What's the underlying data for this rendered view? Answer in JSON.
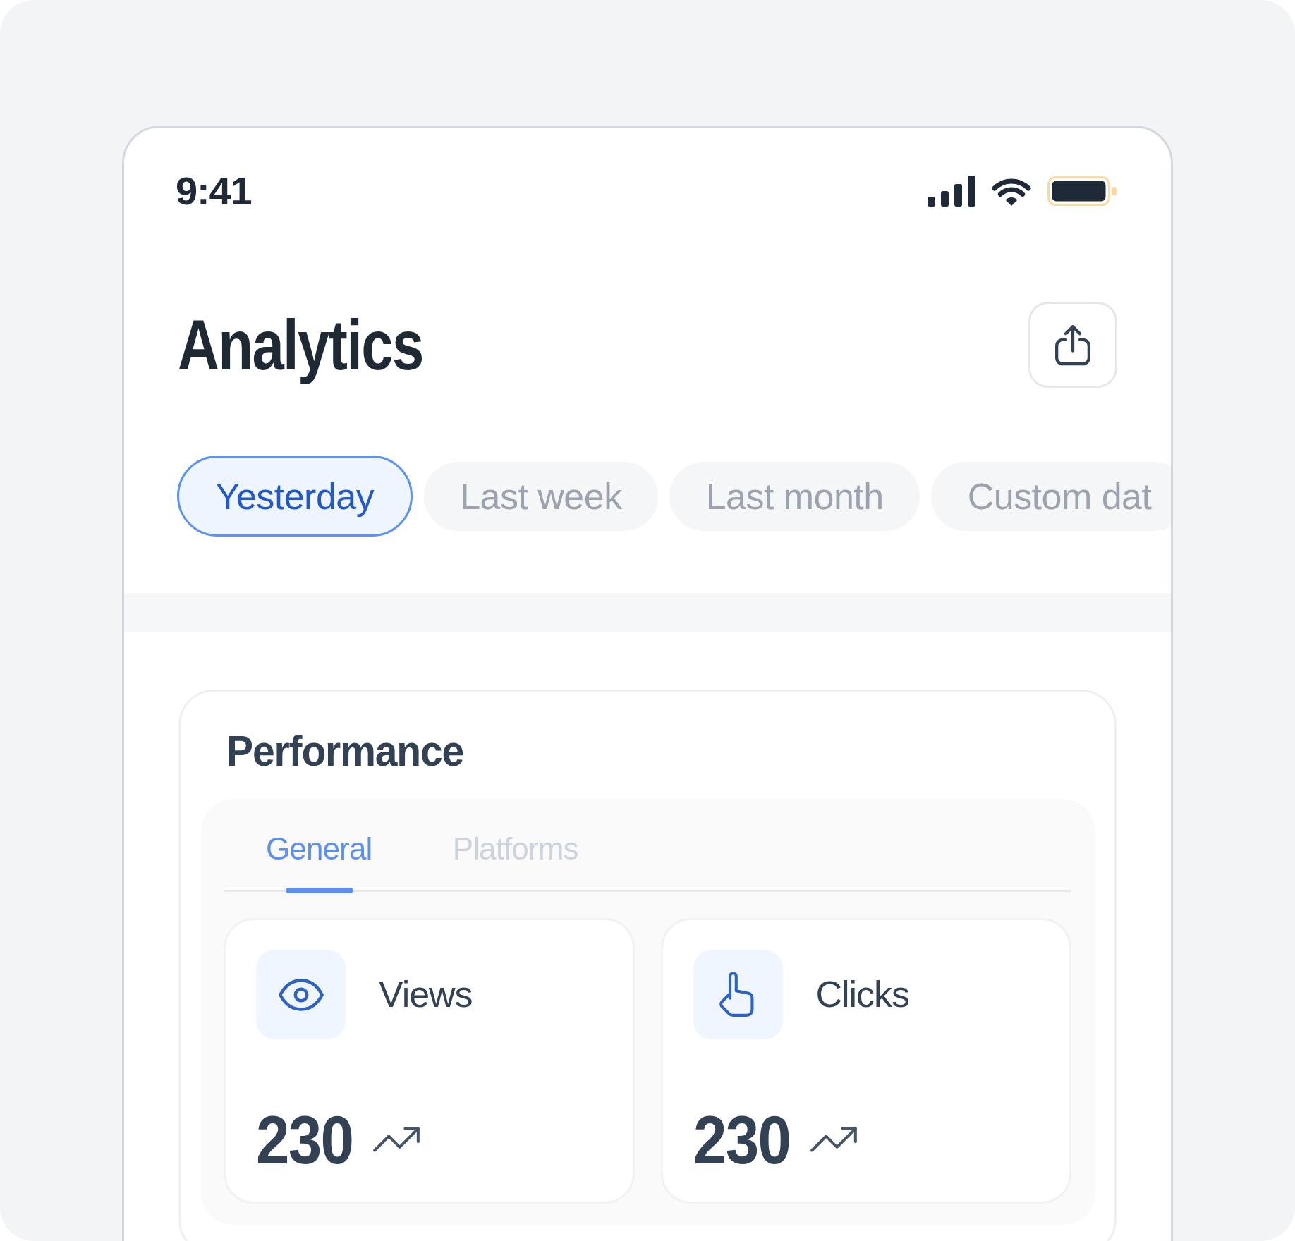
{
  "status_bar": {
    "time": "9:41"
  },
  "header": {
    "title": "Analytics"
  },
  "date_filters": [
    {
      "label": "Yesterday",
      "selected": true
    },
    {
      "label": "Last week",
      "selected": false
    },
    {
      "label": "Last month",
      "selected": false
    },
    {
      "label": "Custom dat",
      "selected": false
    }
  ],
  "performance": {
    "title": "Performance",
    "tabs": [
      {
        "label": "General",
        "selected": true
      },
      {
        "label": "Platforms",
        "selected": false
      }
    ],
    "metrics": [
      {
        "kind": "views",
        "label": "Views",
        "value": "230",
        "trending_up": true
      },
      {
        "kind": "clicks",
        "label": "Clicks",
        "value": "230",
        "trending_up": true
      }
    ]
  }
}
